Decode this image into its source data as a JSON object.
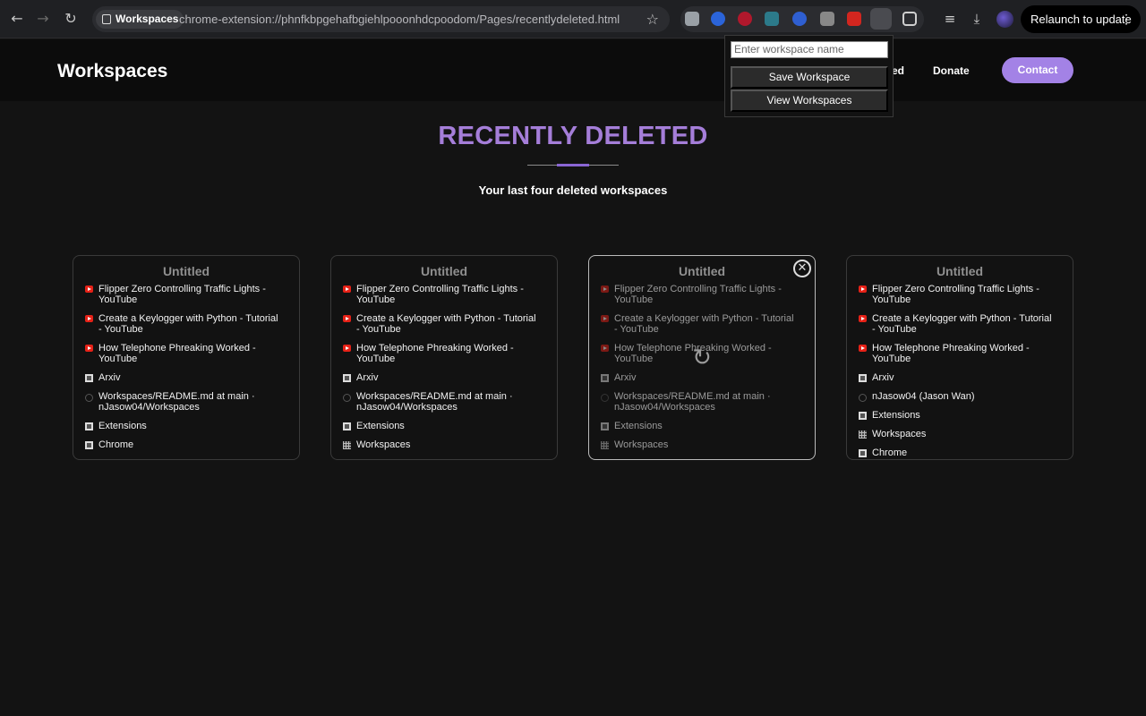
{
  "browser": {
    "back_icon": "←",
    "forward_icon": "→",
    "reload_icon": "↻",
    "tab_chip": "Workspaces",
    "url": "chrome-extension://phnfkbpgehafbgiehlpooonhdcpoodom/Pages/recentlydeleted.html",
    "star_icon": "☆",
    "relaunch": "Relaunch to update",
    "menu_icon": "⋮"
  },
  "header": {
    "brand": "Workspaces",
    "nav_partial": "ed",
    "nav_donate": "Donate",
    "contact": "Contact"
  },
  "main": {
    "title": "RECENTLY DELETED",
    "subtitle": "Your last four deleted workspaces"
  },
  "popup": {
    "placeholder": "Enter workspace name",
    "save": "Save Workspace",
    "view": "View Workspaces"
  },
  "cards": [
    {
      "title": "Untitled",
      "items": [
        {
          "icon": "youtube-icon",
          "label": "Flipper Zero Controlling Traffic Lights - YouTube"
        },
        {
          "icon": "youtube-icon",
          "label": "Create a Keylogger with Python - Tutorial - YouTube"
        },
        {
          "icon": "youtube-icon",
          "label": "How Telephone Phreaking Worked - YouTube"
        },
        {
          "icon": "page-icon",
          "label": "Arxiv"
        },
        {
          "icon": "github-icon",
          "label": "Workspaces/README.md at main · nJasow04/Workspaces"
        },
        {
          "icon": "page-icon",
          "label": "Extensions"
        },
        {
          "icon": "page-icon",
          "label": "Chrome"
        }
      ]
    },
    {
      "title": "Untitled",
      "items": [
        {
          "icon": "youtube-icon",
          "label": "Flipper Zero Controlling Traffic Lights - YouTube"
        },
        {
          "icon": "youtube-icon",
          "label": "Create a Keylogger with Python - Tutorial - YouTube"
        },
        {
          "icon": "youtube-icon",
          "label": "How Telephone Phreaking Worked - YouTube"
        },
        {
          "icon": "page-icon",
          "label": "Arxiv"
        },
        {
          "icon": "github-icon",
          "label": "Workspaces/README.md at main · nJasow04/Workspaces"
        },
        {
          "icon": "page-icon",
          "label": "Extensions"
        },
        {
          "icon": "grid-icon",
          "label": "Workspaces"
        }
      ]
    },
    {
      "title": "Untitled",
      "items": [
        {
          "icon": "youtube-icon",
          "label": "Flipper Zero Controlling Traffic Lights - YouTube"
        },
        {
          "icon": "youtube-icon",
          "label": "Create a Keylogger with Python - Tutorial - YouTube"
        },
        {
          "icon": "youtube-icon",
          "label": "How Telephone Phreaking Worked - YouTube"
        },
        {
          "icon": "page-icon",
          "label": "Arxiv"
        },
        {
          "icon": "github-icon",
          "label": "Workspaces/README.md at main · nJasow04/Workspaces"
        },
        {
          "icon": "page-icon",
          "label": "Extensions"
        },
        {
          "icon": "grid-icon",
          "label": "Workspaces"
        }
      ]
    },
    {
      "title": "Untitled",
      "items": [
        {
          "icon": "youtube-icon",
          "label": "Flipper Zero Controlling Traffic Lights - YouTube"
        },
        {
          "icon": "youtube-icon",
          "label": "Create a Keylogger with Python - Tutorial - YouTube"
        },
        {
          "icon": "youtube-icon",
          "label": "How Telephone Phreaking Worked - YouTube"
        },
        {
          "icon": "page-icon",
          "label": "Arxiv"
        },
        {
          "icon": "github-icon",
          "label": "nJasow04 (Jason Wan)"
        },
        {
          "icon": "page-icon",
          "label": "Extensions"
        },
        {
          "icon": "grid-icon",
          "label": "Workspaces"
        },
        {
          "icon": "page-icon",
          "label": "Chrome"
        }
      ]
    }
  ],
  "card_close_icon": "✕",
  "card_restore_icon": "↻",
  "colors": {
    "accent": "#a382e6",
    "title": "#a57ed9",
    "background": "#131313"
  }
}
